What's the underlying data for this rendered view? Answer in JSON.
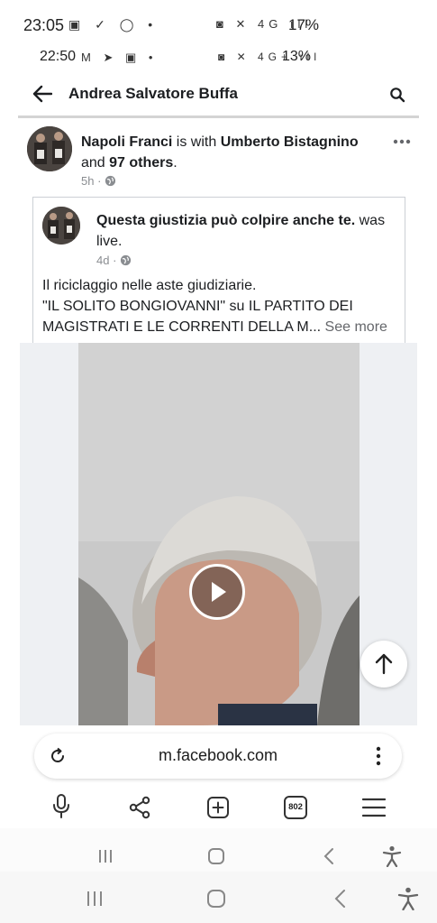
{
  "outer_status_bar": {
    "time": "23:05",
    "left_icons": "▣ ✓ ◯ •",
    "right_icons": "◙ ✕ 4G ıll",
    "battery": "17%"
  },
  "inner_status_bar": {
    "time": "22:50",
    "left_icons": "M ➤ ▣ •",
    "right_icons": "◙ ✕ 4G+ ıll",
    "battery": "13%"
  },
  "header": {
    "title": "Andrea Salvatore Buffa",
    "back_icon": "arrow-left-icon",
    "search_icon": "search-icon"
  },
  "post": {
    "author": "Napoli Franci",
    "with_text": " is with ",
    "tagged": "Umberto Bistagnino",
    "and_text": "and ",
    "others": "97 others",
    "period": ".",
    "time": "5h",
    "sep": "·",
    "more_icon": "more-horizontal-icon"
  },
  "shared": {
    "page_name": "Questa giustizia può colpire anche te.",
    "was_live": " was live.",
    "time": "4d",
    "sep": "·",
    "line1": "Il riciclaggio nelle aste giudiziarie.",
    "line2": "\"IL SOLITO BONGIOVANNI\" su IL PARTITO DEI",
    "line3": "MAGISTRATI E LE CORRENTI DELLA M...",
    "see_more": "See more"
  },
  "video": {
    "play_icon": "play-icon",
    "scroll_top_icon": "arrow-up-icon"
  },
  "browser": {
    "url": "m.facebook.com",
    "reload_icon": "reload-icon",
    "menu_icon": "more-vertical-icon",
    "tab_count": "802"
  }
}
